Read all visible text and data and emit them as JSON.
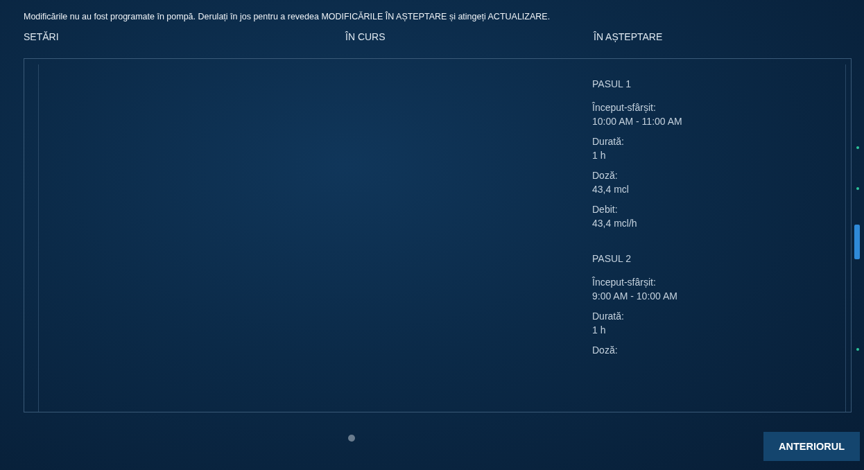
{
  "message": "Modificările nu au fost programate în pompă. Derulați în jos pentru a revedea MODIFICĂRILE ÎN AȘTEPTARE și atingeți ACTUALIZARE.",
  "columns": [
    "SETĂRI",
    "ÎN CURS",
    "ÎN AȘTEPTARE"
  ],
  "pending_steps": [
    {
      "title": "PASUL 1",
      "fields": [
        {
          "label": "Început-sfârșit:",
          "value": "10:00 AM - 11:00 AM"
        },
        {
          "label": "Durată:",
          "value": "1 h"
        },
        {
          "label": "Doză:",
          "value": "43,4 mcl"
        },
        {
          "label": "Debit:",
          "value": "43,4 mcl/h"
        }
      ]
    },
    {
      "title": "PASUL 2",
      "fields": [
        {
          "label": "Început-sfârșit:",
          "value": "9:00 AM - 10:00 AM"
        },
        {
          "label": "Durată:",
          "value": "1 h"
        },
        {
          "label": "Doză:"
        }
      ]
    }
  ],
  "back_button": "ANTERIORUL"
}
